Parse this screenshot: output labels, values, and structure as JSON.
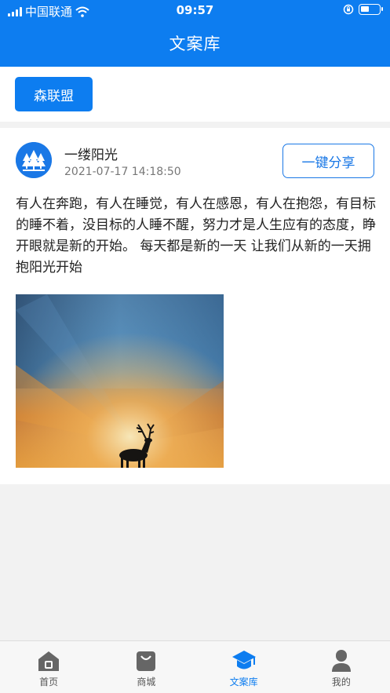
{
  "status_bar": {
    "carrier": "中国联通",
    "time": "09:57"
  },
  "header": {
    "title": "文案库"
  },
  "filter": {
    "tag_label": "森联盟"
  },
  "post": {
    "author": "一缕阳光",
    "datetime": "2021-07-17 14:18:50",
    "share_label": "一键分享",
    "content": "有人在奔跑，有人在睡觉，有人在感恩，有人在抱怨，有目标的睡不着，没目标的人睡不醒，努力才是人生应有的态度，睁开眼就是新的开始。 每天都是新的一天 让我们从新的一天拥抱阳光开始"
  },
  "tabbar": {
    "items": [
      {
        "label": "首页",
        "icon": "home-icon"
      },
      {
        "label": "商城",
        "icon": "shop-bag-icon"
      },
      {
        "label": "文案库",
        "icon": "graduation-cap-icon"
      },
      {
        "label": "我的",
        "icon": "user-icon"
      }
    ],
    "active_index": 2
  },
  "colors": {
    "primary": "#0d7df0",
    "inactive_icon": "#666666"
  }
}
